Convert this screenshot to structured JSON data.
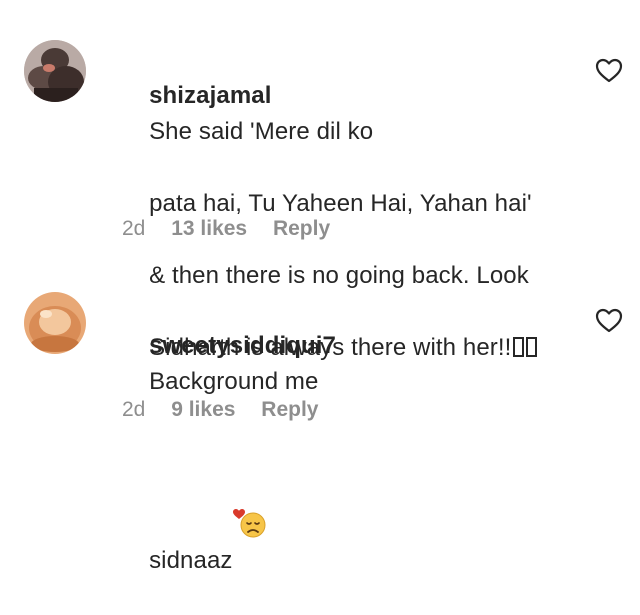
{
  "comments": [
    {
      "username": "shizajamal",
      "text_lines": [
        "She said 'Mere dil ko",
        "pata hai, Tu Yaheen Hai, Yahan hai'",
        "& then there is no going back. Look",
        "Sidharth is always there with her!!"
      ],
      "age": "2d",
      "likes": "13 likes",
      "reply_label": "Reply",
      "avatar_icon": "profile-photo",
      "like_icon": "heart-outline-icon"
    },
    {
      "username": "sweetysiddiqui7",
      "text_lines": [
        "Background me",
        "sidnaaz"
      ],
      "age": "2d",
      "likes": "9 likes",
      "reply_label": "Reply",
      "avatar_icon": "profile-photo",
      "like_icon": "heart-outline-icon",
      "trailing_emoji": "heart-and-sad-face-emoji"
    }
  ],
  "colors": {
    "text": "#262626",
    "meta": "#8e8e8e",
    "background": "#ffffff"
  }
}
